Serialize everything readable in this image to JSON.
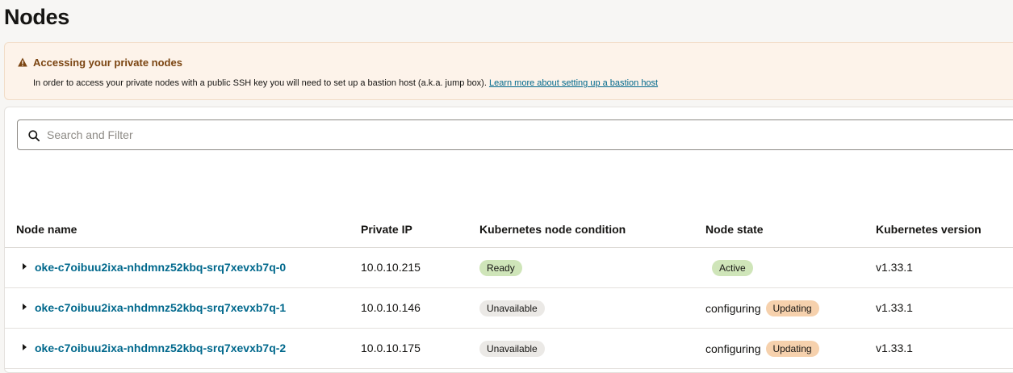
{
  "page": {
    "title": "Nodes"
  },
  "banner": {
    "title": "Accessing your private nodes",
    "body": "In order to access your private nodes with a public SSH key you will need to set up a bastion host (a.k.a. jump box).",
    "link": "Learn more about setting up a bastion host",
    "icon": "warning-icon",
    "accent_color": "#7a4411"
  },
  "search": {
    "placeholder": "Search and Filter",
    "value": ""
  },
  "table": {
    "columns": [
      "Node name",
      "Private IP",
      "Kubernetes node condition",
      "Node state",
      "Kubernetes version"
    ],
    "rows": [
      {
        "name": "oke-c7oibuu2ixa-nhdmnz52kbq-srq7xevxb7q-0",
        "ip": "10.0.10.215",
        "condition": "Ready",
        "state_text": "",
        "state_badge": "Active",
        "version": "v1.33.1"
      },
      {
        "name": "oke-c7oibuu2ixa-nhdmnz52kbq-srq7xevxb7q-1",
        "ip": "10.0.10.146",
        "condition": "Unavailable",
        "state_text": "configuring",
        "state_badge": "Updating",
        "version": "v1.33.1"
      },
      {
        "name": "oke-c7oibuu2ixa-nhdmnz52kbq-srq7xevxb7q-2",
        "ip": "10.0.10.175",
        "condition": "Unavailable",
        "state_text": "configuring",
        "state_badge": "Updating",
        "version": "v1.33.1"
      }
    ]
  },
  "colors": {
    "link": "#00688c",
    "badge_ready": "#cfe5b9",
    "badge_unavailable": "#ebe9e6",
    "badge_updating": "#f6d1ad",
    "banner_bg": "#fdf3ea"
  }
}
